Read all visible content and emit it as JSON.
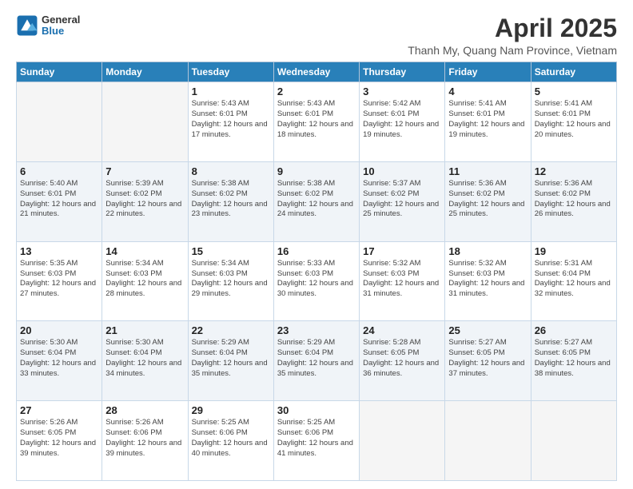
{
  "header": {
    "logo_general": "General",
    "logo_blue": "Blue",
    "month_year": "April 2025",
    "location": "Thanh My, Quang Nam Province, Vietnam"
  },
  "weekdays": [
    "Sunday",
    "Monday",
    "Tuesday",
    "Wednesday",
    "Thursday",
    "Friday",
    "Saturday"
  ],
  "weeks": [
    [
      {
        "day": "",
        "info": ""
      },
      {
        "day": "",
        "info": ""
      },
      {
        "day": "1",
        "info": "Sunrise: 5:43 AM\nSunset: 6:01 PM\nDaylight: 12 hours and 17 minutes."
      },
      {
        "day": "2",
        "info": "Sunrise: 5:43 AM\nSunset: 6:01 PM\nDaylight: 12 hours and 18 minutes."
      },
      {
        "day": "3",
        "info": "Sunrise: 5:42 AM\nSunset: 6:01 PM\nDaylight: 12 hours and 19 minutes."
      },
      {
        "day": "4",
        "info": "Sunrise: 5:41 AM\nSunset: 6:01 PM\nDaylight: 12 hours and 19 minutes."
      },
      {
        "day": "5",
        "info": "Sunrise: 5:41 AM\nSunset: 6:01 PM\nDaylight: 12 hours and 20 minutes."
      }
    ],
    [
      {
        "day": "6",
        "info": "Sunrise: 5:40 AM\nSunset: 6:01 PM\nDaylight: 12 hours and 21 minutes."
      },
      {
        "day": "7",
        "info": "Sunrise: 5:39 AM\nSunset: 6:02 PM\nDaylight: 12 hours and 22 minutes."
      },
      {
        "day": "8",
        "info": "Sunrise: 5:38 AM\nSunset: 6:02 PM\nDaylight: 12 hours and 23 minutes."
      },
      {
        "day": "9",
        "info": "Sunrise: 5:38 AM\nSunset: 6:02 PM\nDaylight: 12 hours and 24 minutes."
      },
      {
        "day": "10",
        "info": "Sunrise: 5:37 AM\nSunset: 6:02 PM\nDaylight: 12 hours and 25 minutes."
      },
      {
        "day": "11",
        "info": "Sunrise: 5:36 AM\nSunset: 6:02 PM\nDaylight: 12 hours and 25 minutes."
      },
      {
        "day": "12",
        "info": "Sunrise: 5:36 AM\nSunset: 6:02 PM\nDaylight: 12 hours and 26 minutes."
      }
    ],
    [
      {
        "day": "13",
        "info": "Sunrise: 5:35 AM\nSunset: 6:03 PM\nDaylight: 12 hours and 27 minutes."
      },
      {
        "day": "14",
        "info": "Sunrise: 5:34 AM\nSunset: 6:03 PM\nDaylight: 12 hours and 28 minutes."
      },
      {
        "day": "15",
        "info": "Sunrise: 5:34 AM\nSunset: 6:03 PM\nDaylight: 12 hours and 29 minutes."
      },
      {
        "day": "16",
        "info": "Sunrise: 5:33 AM\nSunset: 6:03 PM\nDaylight: 12 hours and 30 minutes."
      },
      {
        "day": "17",
        "info": "Sunrise: 5:32 AM\nSunset: 6:03 PM\nDaylight: 12 hours and 31 minutes."
      },
      {
        "day": "18",
        "info": "Sunrise: 5:32 AM\nSunset: 6:03 PM\nDaylight: 12 hours and 31 minutes."
      },
      {
        "day": "19",
        "info": "Sunrise: 5:31 AM\nSunset: 6:04 PM\nDaylight: 12 hours and 32 minutes."
      }
    ],
    [
      {
        "day": "20",
        "info": "Sunrise: 5:30 AM\nSunset: 6:04 PM\nDaylight: 12 hours and 33 minutes."
      },
      {
        "day": "21",
        "info": "Sunrise: 5:30 AM\nSunset: 6:04 PM\nDaylight: 12 hours and 34 minutes."
      },
      {
        "day": "22",
        "info": "Sunrise: 5:29 AM\nSunset: 6:04 PM\nDaylight: 12 hours and 35 minutes."
      },
      {
        "day": "23",
        "info": "Sunrise: 5:29 AM\nSunset: 6:04 PM\nDaylight: 12 hours and 35 minutes."
      },
      {
        "day": "24",
        "info": "Sunrise: 5:28 AM\nSunset: 6:05 PM\nDaylight: 12 hours and 36 minutes."
      },
      {
        "day": "25",
        "info": "Sunrise: 5:27 AM\nSunset: 6:05 PM\nDaylight: 12 hours and 37 minutes."
      },
      {
        "day": "26",
        "info": "Sunrise: 5:27 AM\nSunset: 6:05 PM\nDaylight: 12 hours and 38 minutes."
      }
    ],
    [
      {
        "day": "27",
        "info": "Sunrise: 5:26 AM\nSunset: 6:05 PM\nDaylight: 12 hours and 39 minutes."
      },
      {
        "day": "28",
        "info": "Sunrise: 5:26 AM\nSunset: 6:06 PM\nDaylight: 12 hours and 39 minutes."
      },
      {
        "day": "29",
        "info": "Sunrise: 5:25 AM\nSunset: 6:06 PM\nDaylight: 12 hours and 40 minutes."
      },
      {
        "day": "30",
        "info": "Sunrise: 5:25 AM\nSunset: 6:06 PM\nDaylight: 12 hours and 41 minutes."
      },
      {
        "day": "",
        "info": ""
      },
      {
        "day": "",
        "info": ""
      },
      {
        "day": "",
        "info": ""
      }
    ]
  ]
}
